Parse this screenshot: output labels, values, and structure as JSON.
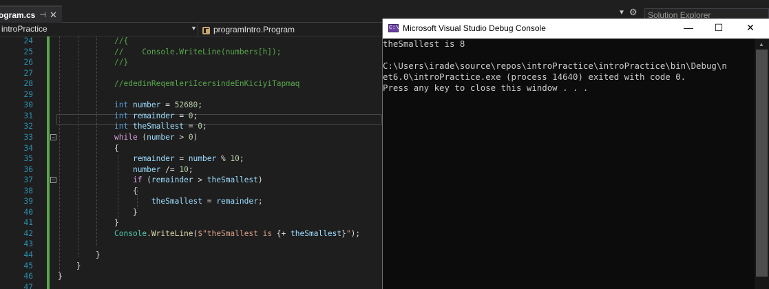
{
  "tab": {
    "title": "ogram.cs",
    "pin": "⊣",
    "close": "✕"
  },
  "topright": {
    "solution_explorer": "Solution Explorer"
  },
  "nav": {
    "project": "introPractice",
    "class": "programIntro.Program"
  },
  "editor": {
    "lines": [
      {
        "n": "24",
        "segs": [
          [
            "c-com",
            "//{"
          ]
        ]
      },
      {
        "n": "25",
        "segs": [
          [
            "c-com",
            "//    Console.WriteLine(numbers[h]);"
          ]
        ]
      },
      {
        "n": "26",
        "segs": [
          [
            "c-com",
            "//}"
          ]
        ]
      },
      {
        "n": "27",
        "segs": []
      },
      {
        "n": "28",
        "segs": [
          [
            "c-com",
            "//ededinReqemleriIcersindeEnKiciyiTapmaq"
          ]
        ]
      },
      {
        "n": "29",
        "segs": []
      },
      {
        "n": "30",
        "segs": [
          [
            "c-kw",
            "int "
          ],
          [
            "c-var",
            "number"
          ],
          [
            "c-txt",
            " = "
          ],
          [
            "c-num",
            "52680"
          ],
          [
            "c-txt",
            ";"
          ]
        ]
      },
      {
        "n": "31",
        "segs": [
          [
            "c-kw",
            "int "
          ],
          [
            "c-var",
            "remainder"
          ],
          [
            "c-txt",
            " = "
          ],
          [
            "c-num",
            "0"
          ],
          [
            "c-txt",
            ";"
          ]
        ]
      },
      {
        "n": "32",
        "segs": [
          [
            "c-kw",
            "int "
          ],
          [
            "c-var",
            "theSmallest"
          ],
          [
            "c-txt",
            " = "
          ],
          [
            "c-num",
            "0"
          ],
          [
            "c-txt",
            ";"
          ]
        ]
      },
      {
        "n": "33",
        "segs": [
          [
            "c-ctl",
            "while"
          ],
          [
            "c-txt",
            " ("
          ],
          [
            "c-var",
            "number"
          ],
          [
            "c-txt",
            " > "
          ],
          [
            "c-num",
            "0"
          ],
          [
            "c-txt",
            ")"
          ]
        ]
      },
      {
        "n": "34",
        "segs": [
          [
            "c-txt",
            "{"
          ]
        ]
      },
      {
        "n": "35",
        "segs": [
          [
            "c-txt",
            "    "
          ],
          [
            "c-var",
            "remainder"
          ],
          [
            "c-txt",
            " = "
          ],
          [
            "c-var",
            "number"
          ],
          [
            "c-txt",
            " % "
          ],
          [
            "c-num",
            "10"
          ],
          [
            "c-txt",
            ";"
          ]
        ]
      },
      {
        "n": "36",
        "segs": [
          [
            "c-txt",
            "    "
          ],
          [
            "c-var",
            "number"
          ],
          [
            "c-txt",
            " /= "
          ],
          [
            "c-num",
            "10"
          ],
          [
            "c-txt",
            ";"
          ]
        ]
      },
      {
        "n": "37",
        "segs": [
          [
            "c-txt",
            "    "
          ],
          [
            "c-ctl",
            "if"
          ],
          [
            "c-txt",
            " ("
          ],
          [
            "c-var",
            "remainder"
          ],
          [
            "c-txt",
            " > "
          ],
          [
            "c-var",
            "theSmallest"
          ],
          [
            "c-txt",
            ")"
          ]
        ]
      },
      {
        "n": "38",
        "segs": [
          [
            "c-txt",
            "    {"
          ]
        ]
      },
      {
        "n": "39",
        "segs": [
          [
            "c-txt",
            "        "
          ],
          [
            "c-var",
            "theSmallest"
          ],
          [
            "c-txt",
            " = "
          ],
          [
            "c-var",
            "remainder"
          ],
          [
            "c-txt",
            ";"
          ]
        ]
      },
      {
        "n": "40",
        "segs": [
          [
            "c-txt",
            "    }"
          ]
        ]
      },
      {
        "n": "41",
        "segs": [
          [
            "c-txt",
            "}"
          ]
        ]
      },
      {
        "n": "42",
        "segs": [
          [
            "c-type",
            "Console"
          ],
          [
            "c-txt",
            "."
          ],
          [
            "c-meth",
            "WriteLine"
          ],
          [
            "c-txt",
            "("
          ],
          [
            "c-str",
            "$\"theSmallest is "
          ],
          [
            "c-txt",
            "{"
          ],
          [
            "c-txt",
            "+ "
          ],
          [
            "c-var",
            "theSmallest"
          ],
          [
            "c-txt",
            "}"
          ],
          [
            "c-str",
            "\""
          ],
          [
            "c-txt",
            ");"
          ]
        ]
      },
      {
        "n": "43",
        "segs": []
      },
      {
        "n": "44",
        "segs": [
          [
            "c-txt",
            "}"
          ]
        ]
      },
      {
        "n": "45",
        "segs": [
          [
            "c-txt",
            "}"
          ]
        ]
      },
      {
        "n": "46",
        "segs": [
          [
            "c-txt",
            "}"
          ]
        ]
      },
      {
        "n": "47",
        "segs": []
      }
    ]
  },
  "console": {
    "title": "Microsoft Visual Studio Debug Console",
    "icon_text": "C:\\",
    "minimize": "—",
    "maximize": "☐",
    "close": "✕",
    "output": "theSmallest is 8\n\nC:\\Users\\irade\\source\\repos\\introPractice\\introPractice\\bin\\Debug\\n\net6.0\\introPractice.exe (process 14640) exited with code 0.\nPress any key to close this window . . ."
  }
}
